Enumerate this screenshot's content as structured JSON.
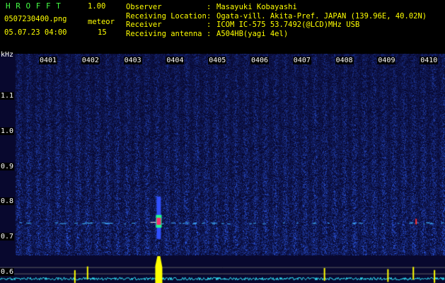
{
  "header": {
    "app_title": "H R O F F T",
    "version": "1.00",
    "filename": "0507230400.png",
    "meteor_label": "meteor",
    "datetime": "05.07.23 04:00",
    "meteor_count": "15"
  },
  "station": [
    {
      "key": "Observer",
      "sep": ":",
      "value": "Masayuki Kobayashi"
    },
    {
      "key": "Receiving Location",
      "sep": ":",
      "value": "Ogata-vill. Akita-Pref. JAPAN (139.96E, 40.02N)"
    },
    {
      "key": "Receiver",
      "sep": ":",
      "value": "ICOM IC-575 53.7492(@LCD)MHz USB"
    },
    {
      "key": "Receiving antenna",
      "sep": ":",
      "value": "A504HB(yagi 4el)"
    }
  ],
  "chart_data": {
    "type": "heatmap",
    "ylabel": "kHz",
    "x_ticks": [
      "0401",
      "0402",
      "0403",
      "0404",
      "0405",
      "0406",
      "0407",
      "0408",
      "0409",
      "0410"
    ],
    "y_ticks": [
      "1.1",
      "1.0",
      "0.9",
      "0.8",
      "0.7",
      "0.6"
    ],
    "ylim": [
      0.57,
      1.22
    ],
    "signal_band_khz": 0.74,
    "meteor_echo": {
      "time": "0403.8",
      "freq_khz": 0.745
    },
    "colors": {
      "background": "#08082e",
      "noise": "#1a3cc8",
      "signal": "#40b0ff",
      "echo_peak": "#ff3070",
      "echo_mid": "#20ff90",
      "level": "#30e8ff",
      "peak": "#ffff00"
    }
  }
}
